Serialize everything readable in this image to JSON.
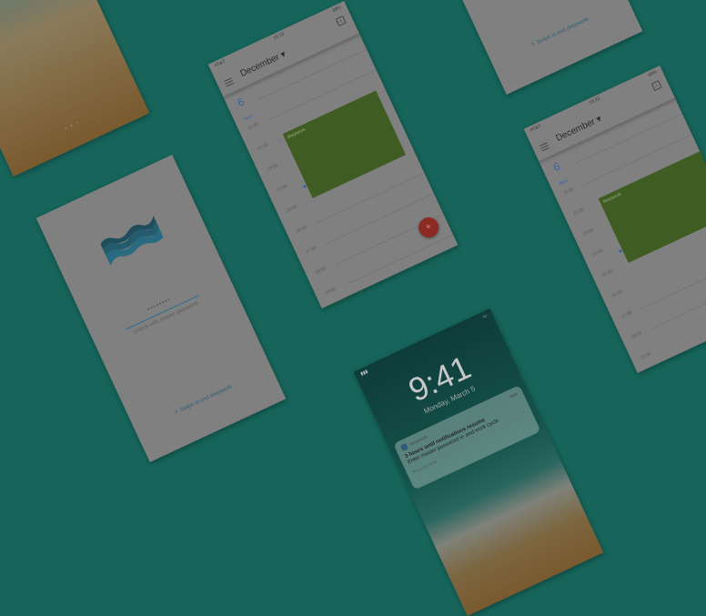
{
  "colors": {
    "background": "#16645a",
    "event": "#3f5c22",
    "fab": "#8e2a24",
    "accent": "#3b5fa0"
  },
  "calendar": {
    "carrier": "AT&T",
    "time": "15:23",
    "battery": "89%",
    "month": "December",
    "day_number": "6",
    "day_name": "Wed",
    "hours": [
      "11:00",
      "12:00",
      "13:00",
      "14:00",
      "15:00",
      "16:00",
      "17:00",
      "18:00",
      "19:00"
    ],
    "event_title": "deepwork",
    "fab_label": "+",
    "calendar_icon_day": "6"
  },
  "password_screen": {
    "password_mask": "••••••••",
    "unlock_label": "Unlock with master password",
    "swipe_label": "Swipe to end deepwork",
    "chevron": "›"
  },
  "lock_screen": {
    "time": "9:41",
    "date": "Monday, March 5",
    "notification": {
      "app": "deepwork",
      "when": "now",
      "title": "3 hours until notifications resume",
      "body": "Enter master password to end work cycle",
      "more": "Press for more"
    },
    "page_dots": "• • ◦"
  }
}
